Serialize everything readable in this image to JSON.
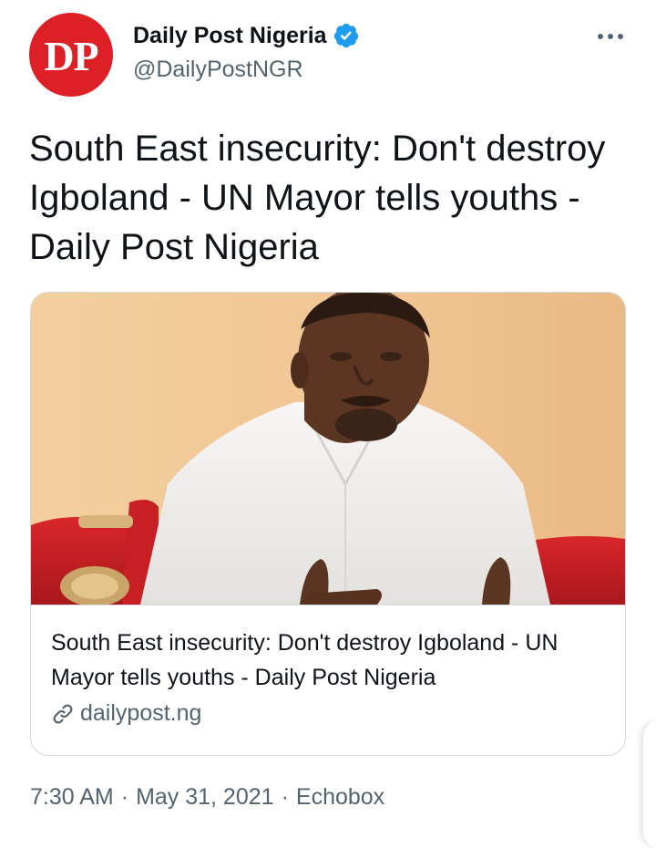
{
  "author": {
    "avatar_text": "DP",
    "display_name": "Daily Post Nigeria",
    "handle": "@DailyPostNGR",
    "verified": true,
    "avatar_color": "#dd1f26",
    "verified_color": "#1d9bf0"
  },
  "more_icon": "more-horizontal-icon",
  "tweet": {
    "text": "South East insecurity: Don't destroy Igboland - UN Mayor tells youths - Daily Post Nigeria"
  },
  "card": {
    "title": "South East insecurity: Don't destroy Igboland - UN Mayor tells youths - Daily Post Nigeria",
    "domain": "dailypost.ng",
    "domain_icon": "link-icon"
  },
  "meta": {
    "time": "7:30 AM",
    "separator": "·",
    "date": "May 31, 2021",
    "source": "Echobox"
  },
  "colors": {
    "text_primary": "#0f1419",
    "text_secondary": "#536471",
    "border": "#cfd9de"
  }
}
